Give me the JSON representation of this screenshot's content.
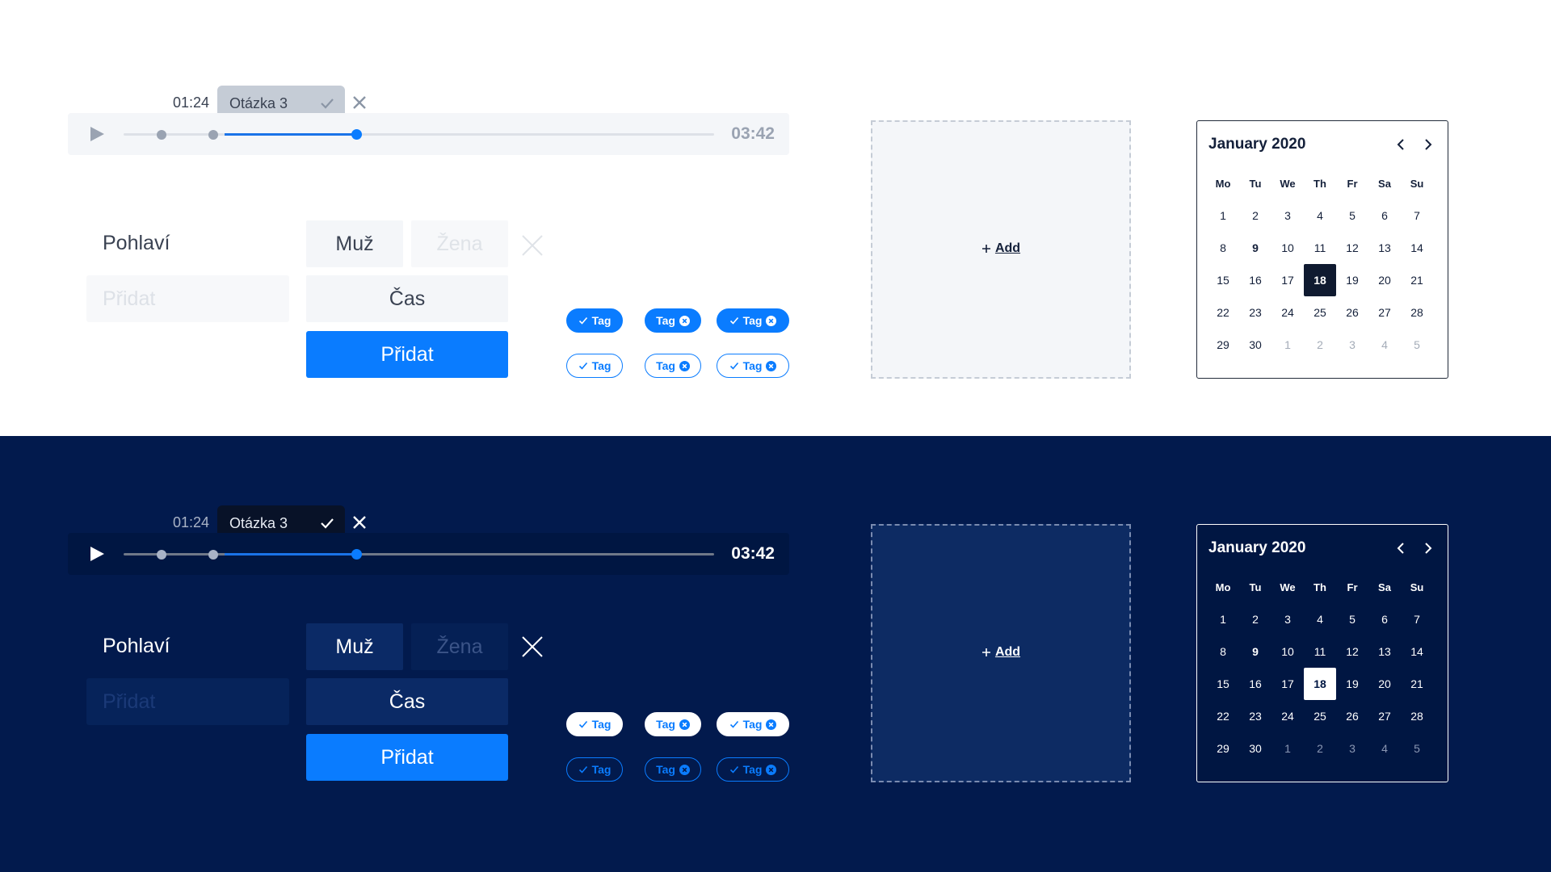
{
  "player": {
    "current_time": "01:24",
    "question_label": "Otázka 3",
    "total_time": "03:42",
    "progress_fraction": 0.3
  },
  "form": {
    "label": "Pohlaví",
    "option_male": "Muž",
    "option_female": "Žena",
    "add_placeholder": "Přidat",
    "time_label": "Čas",
    "submit_label": "Přidat"
  },
  "tags": {
    "label": "Tag"
  },
  "add_box": {
    "label": "Add"
  },
  "calendar": {
    "title": "January 2020",
    "weekdays": [
      "Mo",
      "Tu",
      "We",
      "Th",
      "Fr",
      "Sa",
      "Su"
    ],
    "weeks": [
      [
        "1",
        "2",
        "3",
        "4",
        "5",
        "6",
        "7"
      ],
      [
        "8",
        "9",
        "10",
        "11",
        "12",
        "13",
        "14"
      ],
      [
        "15",
        "16",
        "17",
        "18",
        "19",
        "20",
        "21"
      ],
      [
        "22",
        "23",
        "24",
        "25",
        "26",
        "27",
        "28"
      ],
      [
        "29",
        "30",
        "1",
        "2",
        "3",
        "4",
        "5"
      ]
    ],
    "today": "9",
    "selected": "18"
  },
  "colors": {
    "accent": "#0a7cff",
    "dark_background": "#021a4d"
  }
}
